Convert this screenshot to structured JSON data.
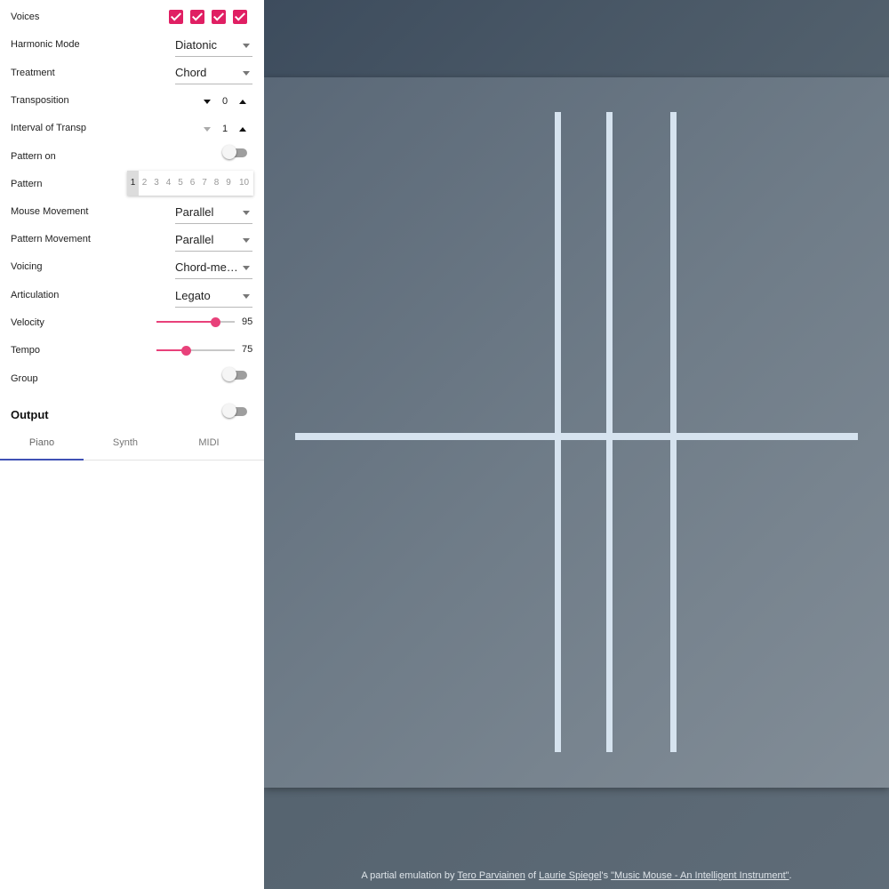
{
  "controls": {
    "voices_label": "Voices",
    "voices": [
      true,
      true,
      true,
      true
    ],
    "harmonic_mode": {
      "label": "Harmonic Mode",
      "value": "Diatonic"
    },
    "treatment": {
      "label": "Treatment",
      "value": "Chord"
    },
    "transposition": {
      "label": "Transposition",
      "value": "0"
    },
    "interval": {
      "label": "Interval of Transp",
      "value": "1"
    },
    "pattern_on": {
      "label": "Pattern on",
      "on": false
    },
    "pattern": {
      "label": "Pattern",
      "options": [
        "1",
        "2",
        "3",
        "4",
        "5",
        "6",
        "7",
        "8",
        "9",
        "10"
      ],
      "selected": "1"
    },
    "mouse_movement": {
      "label": "Mouse Movement",
      "value": "Parallel"
    },
    "pattern_movement": {
      "label": "Pattern Movement",
      "value": "Parallel"
    },
    "voicing": {
      "label": "Voicing",
      "value": "Chord-melo..."
    },
    "articulation": {
      "label": "Articulation",
      "value": "Legato"
    },
    "velocity": {
      "label": "Velocity",
      "value": "95",
      "fraction": 0.75
    },
    "tempo": {
      "label": "Tempo",
      "value": "75",
      "fraction": 0.37
    },
    "group": {
      "label": "Group",
      "on": false
    }
  },
  "output": {
    "title": "Output",
    "on": false,
    "tabs": [
      "Piano",
      "Synth",
      "MIDI"
    ],
    "active_tab": "Piano"
  },
  "credit": {
    "prefix": "A partial emulation by ",
    "author": "Tero Parviainen",
    "mid": " of ",
    "creator": "Laurie Spiegel",
    "possessive": "'s ",
    "work": "\"Music Mouse - An Intelligent Instrument\"",
    "suffix": "."
  },
  "colors": {
    "accent": "#e01f63",
    "tab_indicator": "#3f51b5",
    "lines": "#d6e3ef"
  }
}
